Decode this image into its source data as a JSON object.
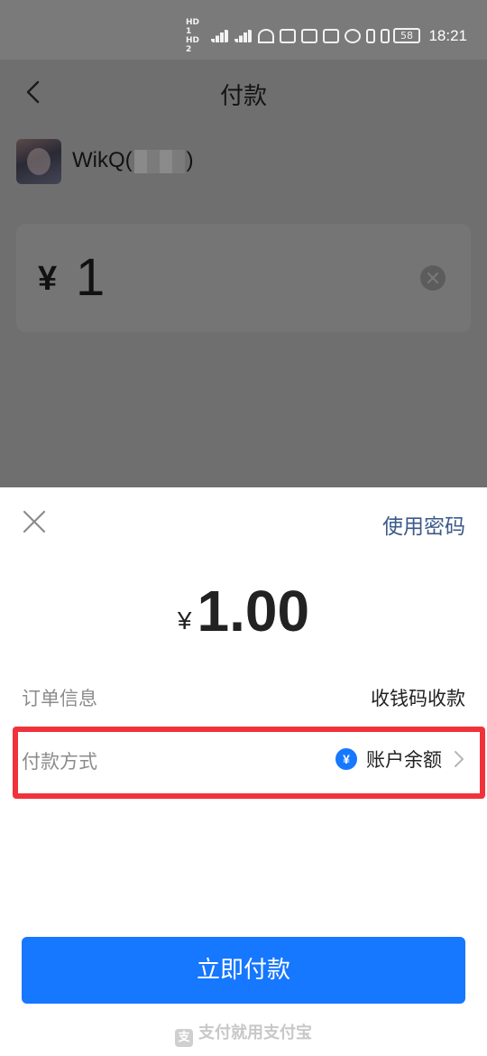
{
  "status_bar": {
    "network_a": "HD 1",
    "network_b": "HD 2",
    "battery": "58",
    "time": "18:21"
  },
  "page": {
    "title": "付款",
    "payee_name_prefix": "WikQ(",
    "payee_name_suffix": ")",
    "currency_symbol": "¥",
    "amount_input": "1"
  },
  "sheet": {
    "use_password": "使用密码",
    "currency_symbol": "¥",
    "amount": "1.00",
    "order_label": "订单信息",
    "order_value": "收钱码收款",
    "method_label": "付款方式",
    "method_icon": "¥",
    "method_value": "账户余额",
    "pay_button": "立即付款",
    "footer": "支付就用支付宝"
  },
  "colors": {
    "accent": "#1677ff",
    "highlight": "#f2323a",
    "link": "#3b5a8a"
  }
}
